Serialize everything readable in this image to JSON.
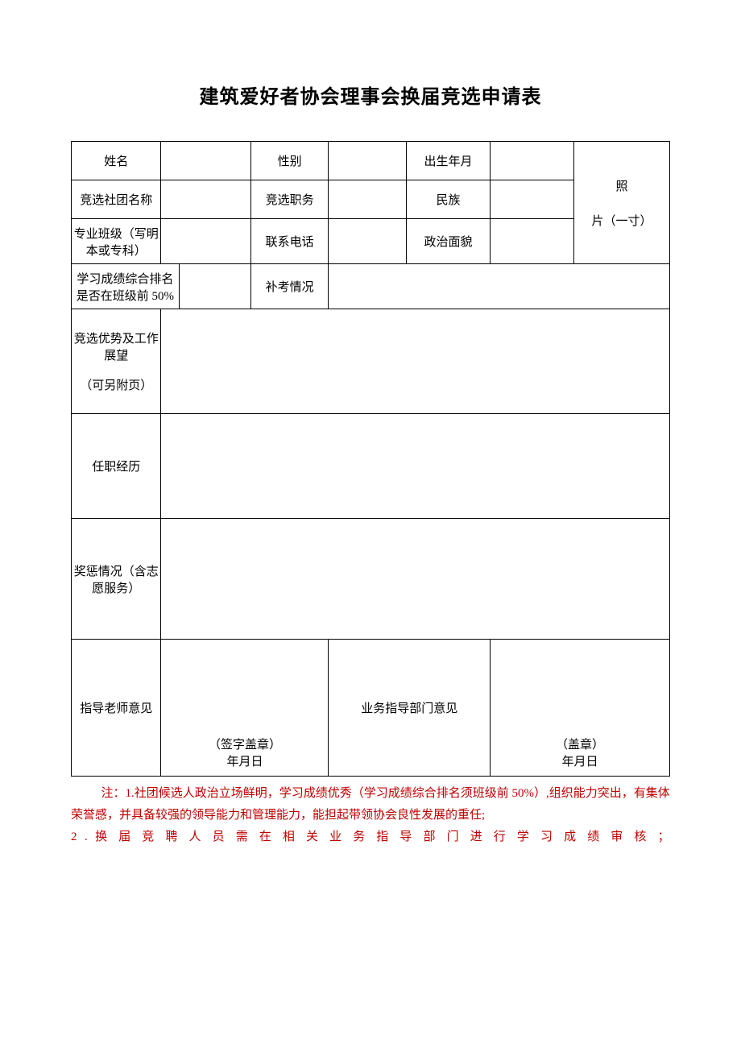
{
  "title": "建筑爱好者协会理事会换届竞选申请表",
  "labels": {
    "name": "姓名",
    "gender": "性别",
    "birth": "出生年月",
    "club": "竞选社团名称",
    "position": "竞选职务",
    "ethnic": "民族",
    "class": "专业班级（写明本或专科）",
    "phone": "联系电话",
    "political": "政治面貌",
    "photo_line1": "照",
    "photo_line2": "片（一寸）",
    "rank": "学习成绩综合排名是否在班级前 50%",
    "retake": "补考情况",
    "advantage_line1": "竞选优势及工作展望",
    "advantage_line2": "（可另附页）",
    "experience": "任职经历",
    "reward": "奖惩情况（含志愿服务）",
    "teacher_opinion": "指导老师意见",
    "dept_opinion": "业务指导部门意见",
    "sign_stamp": "（签字盖章）",
    "stamp": "（盖章）",
    "date": "年月日"
  },
  "notes": {
    "line1": "注：1.社团候选人政治立场鲜明，学习成绩优秀（学习成绩综合排名须班级前 50%）,组织能力突出，有集体荣誉感，并具备较强的领导能力和管理能力，能担起带领协会良性发展的重任;",
    "line2": "2 . 换 届 竞 聘 人 员 需 在 相 关 业 务 指 导 部 门 进 行 学 习 成 绩 审 核 ；"
  }
}
